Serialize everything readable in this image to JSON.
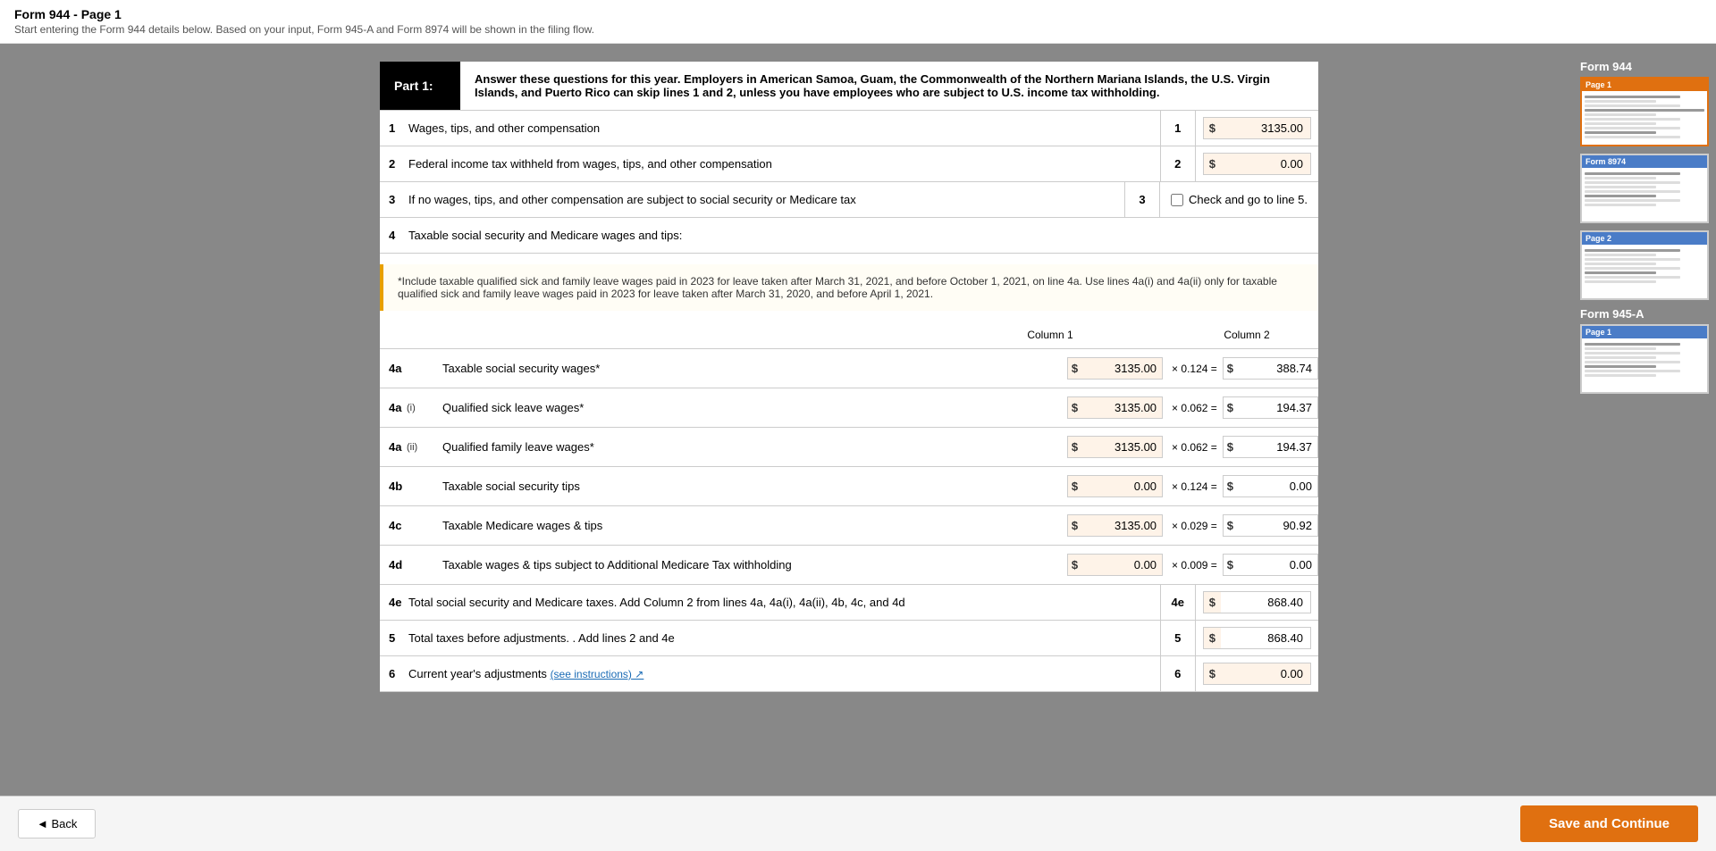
{
  "pageTitle": "Form 944 - Page 1",
  "subtitle": "Start entering the Form 944 details below. Based on your input, Form 945-A and Form 8974 will be shown in the filing flow.",
  "part1": {
    "label": "Part 1:",
    "description": "Answer these questions for this year. Employers in American Samoa, Guam, the Commonwealth of the Northern Mariana Islands, the U.S. Virgin Islands, and Puerto Rico can skip lines 1 and 2, unless you have employees who are subject to U.S. income tax withholding."
  },
  "rows": [
    {
      "num": "1",
      "label": "Wages, tips, and other compensation",
      "lineNum": "1",
      "value": "3135.00",
      "type": "input"
    },
    {
      "num": "2",
      "label": "Federal income tax withheld from wages, tips, and other compensation",
      "lineNum": "2",
      "value": "0.00",
      "type": "input"
    },
    {
      "num": "3",
      "label": "If no wages, tips, and other compensation are subject to social security or Medicare tax",
      "lineNum": "3",
      "checkboxLabel": "Check and go to line 5.",
      "type": "checkbox"
    },
    {
      "num": "4",
      "label": "Taxable social security and Medicare wages and tips:",
      "type": "label"
    }
  ],
  "noteBox": "*Include taxable qualified sick and family leave wages paid in 2023 for leave taken after March 31, 2021, and before October 1, 2021, on line 4a. Use lines 4a(i) and 4a(ii) only for taxable qualified sick and family leave wages paid in 2023 for leave taken after March 31, 2020, and before April 1, 2021.",
  "columnHeaders": {
    "col1": "Column 1",
    "col2": "Column 2"
  },
  "calcRows": [
    {
      "num": "4a",
      "sub": "",
      "label": "Taxable social security wages*",
      "col1": "3135.00",
      "multiplier": "× 0.124 =",
      "col2": "388.74"
    },
    {
      "num": "4a",
      "sub": "(i)",
      "label": "Qualified sick leave wages*",
      "col1": "3135.00",
      "multiplier": "× 0.062 =",
      "col2": "194.37"
    },
    {
      "num": "4a",
      "sub": "(ii)",
      "label": "Qualified family leave wages*",
      "col1": "3135.00",
      "multiplier": "× 0.062 =",
      "col2": "194.37"
    },
    {
      "num": "4b",
      "sub": "",
      "label": "Taxable social security tips",
      "col1": "0.00",
      "multiplier": "× 0.124 =",
      "col2": "0.00"
    },
    {
      "num": "4c",
      "sub": "",
      "label": "Taxable Medicare wages & tips",
      "col1": "3135.00",
      "multiplier": "× 0.029 =",
      "col2": "90.92"
    },
    {
      "num": "4d",
      "sub": "",
      "label": "Taxable wages & tips subject to Additional Medicare Tax withholding",
      "col1": "0.00",
      "multiplier": "× 0.009 =",
      "col2": "0.00"
    }
  ],
  "row4e": {
    "num": "4e",
    "label": "Total social security and Medicare taxes. Add Column 2 from lines 4a, 4a(i), 4a(ii), 4b, 4c, and 4d",
    "lineNum": "4e",
    "value": "868.40"
  },
  "row5": {
    "num": "5",
    "label": "Total taxes before adjustments. . Add lines 2 and 4e",
    "lineNum": "5",
    "value": "868.40"
  },
  "row6": {
    "num": "6",
    "label": "Current year's adjustments",
    "linkText": "(see instructions)",
    "lineNum": "6",
    "value": "0.00"
  },
  "sidebar": {
    "sections": [
      {
        "title": "Form 944",
        "pages": [
          {
            "label": "Page 1",
            "active": true,
            "headerColor": "orange"
          }
        ]
      },
      {
        "title": "",
        "pages": [
          {
            "label": "Form 8974",
            "active": false,
            "headerColor": "blue"
          }
        ]
      },
      {
        "title": "",
        "pages": [
          {
            "label": "Page 2",
            "active": false,
            "headerColor": "blue"
          }
        ]
      },
      {
        "title": "Form 945-A",
        "pages": [
          {
            "label": "Page 1",
            "active": false,
            "headerColor": "blue"
          }
        ]
      }
    ]
  },
  "buttons": {
    "back": "◄ Back",
    "saveContinue": "Save and Continue"
  }
}
